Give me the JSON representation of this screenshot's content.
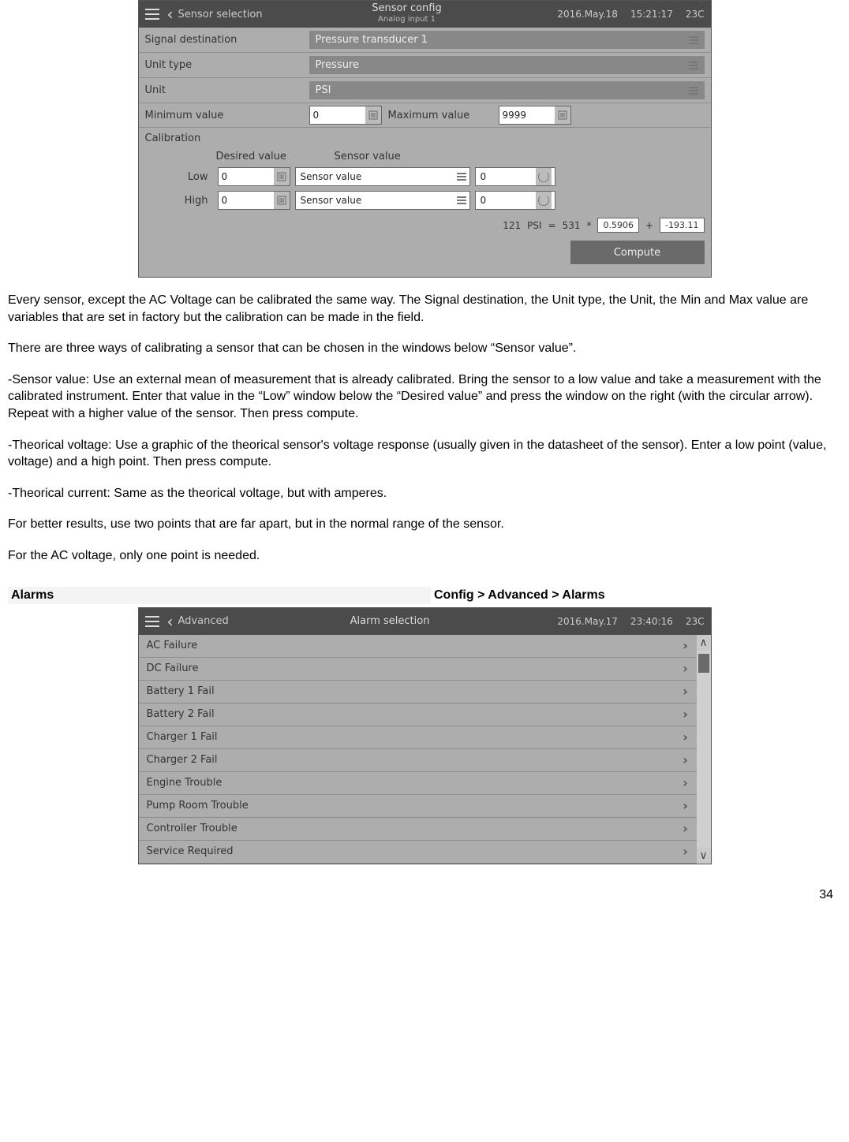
{
  "sensor_config": {
    "titlebar": {
      "crumb": "Sensor selection",
      "title": "Sensor config",
      "subtitle": "Analog input 1",
      "date": "2016.May.18",
      "time": "15:21:17",
      "temp": "23C"
    },
    "rows": {
      "signal_destination": {
        "label": "Signal destination",
        "value": "Pressure transducer 1"
      },
      "unit_type": {
        "label": "Unit type",
        "value": "Pressure"
      },
      "unit": {
        "label": "Unit",
        "value": "PSI"
      },
      "min": {
        "label": "Minimum value",
        "value": "0"
      },
      "max": {
        "label": "Maximum value",
        "value": "9999"
      }
    },
    "calibration": {
      "label": "Calibration",
      "desired_header": "Desired value",
      "sensor_header": "Sensor value",
      "low": {
        "label": "Low",
        "desired": "0",
        "mode": "Sensor value",
        "sensor": "0"
      },
      "high": {
        "label": "High",
        "desired": "0",
        "mode": "Sensor value",
        "sensor": "0"
      },
      "formula": {
        "lhs_val": "121",
        "lhs_unit": "PSI",
        "eq": "=",
        "a": "531",
        "star": "*",
        "m": "0.5906",
        "plus": "+",
        "b": "-193.11"
      },
      "compute_label": "Compute"
    }
  },
  "body": {
    "p1": "Every sensor, except the AC Voltage can be calibrated the same way. The Signal destination, the Unit type, the Unit, the Min and Max value are variables that are set in factory but the calibration can be made in the field.",
    "p2": "There are three ways of calibrating a sensor that can be chosen in the windows below “Sensor value”.",
    "p3": "-Sensor value: Use an external mean of measurement that is already calibrated. Bring the sensor to a low value and take a measurement with the calibrated instrument. Enter that value in the “Low” window below the “Desired value” and press the window on the right (with the circular arrow). Repeat with a higher value of the sensor. Then press compute.",
    "p4": "-Theorical voltage: Use a graphic of the theorical sensor's voltage response (usually given in the datasheet of the sensor). Enter a low point (value, voltage) and a high point. Then press compute.",
    "p5": "-Theorical current: Same as the theorical voltage, but with amperes.",
    "p6": "For better results, use two points that are far apart, but in the normal range of the sensor.",
    "p7": "For the AC voltage, only one point is needed."
  },
  "alarms_header": {
    "left": "Alarms",
    "right": "Config > Advanced > Alarms"
  },
  "alarm_screen": {
    "titlebar": {
      "crumb": "Advanced",
      "title": "Alarm selection",
      "date": "2016.May.17",
      "time": "23:40:16",
      "temp": "23C"
    },
    "items": [
      "AC Failure",
      "DC Failure",
      "Battery 1 Fail",
      "Battery 2 Fail",
      "Charger 1 Fail",
      "Charger 2 Fail",
      "Engine Trouble",
      "Pump Room Trouble",
      "Controller Trouble",
      "Service Required"
    ]
  },
  "page_number": "34"
}
